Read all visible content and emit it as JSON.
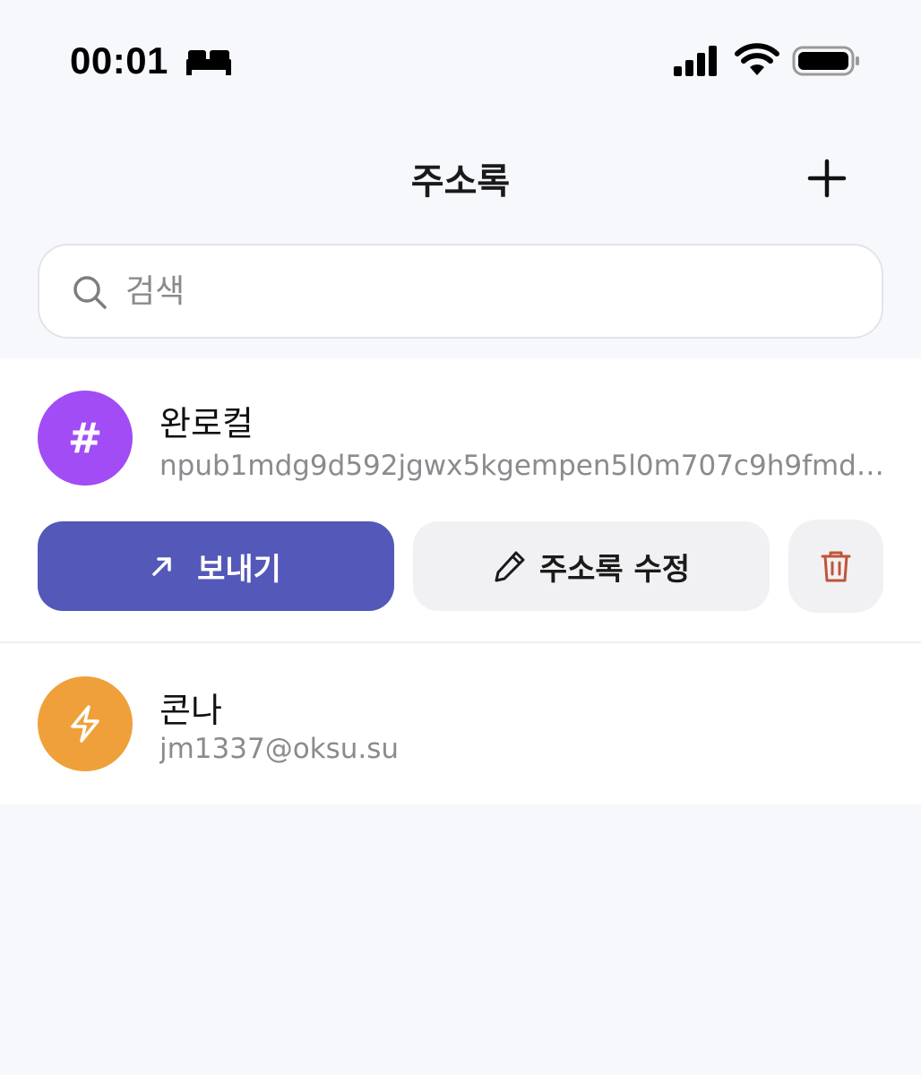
{
  "status_bar": {
    "time": "00:01",
    "icons": [
      "bed-icon",
      "cellular-signal-icon",
      "wifi-icon",
      "battery-icon"
    ]
  },
  "header": {
    "title": "주소록",
    "add_icon": "plus-icon"
  },
  "search": {
    "placeholder": "검색",
    "value": "",
    "icon": "search-icon"
  },
  "contacts": [
    {
      "name": "완로컬",
      "address": "npub1mdg9d592jgwx5kgempen5l0m707c9h9fmdg...",
      "avatar_glyph": "#",
      "avatar_color": "#a14cf4",
      "expanded": true,
      "actions": {
        "send_label": "보내기",
        "send_icon": "arrow-up-right-icon",
        "edit_label": "주소록 수정",
        "edit_icon": "pencil-icon",
        "delete_icon": "trash-icon"
      }
    },
    {
      "name": "콘나",
      "address": "jm1337@oksu.su",
      "avatar_icon": "lightning-bolt-icon",
      "avatar_color": "#f0a03a",
      "expanded": false
    }
  ],
  "colors": {
    "background": "#f7f8fc",
    "primary": "#5458b9",
    "secondary_button": "#f1f1f3",
    "delete_accent": "#c0543a"
  }
}
